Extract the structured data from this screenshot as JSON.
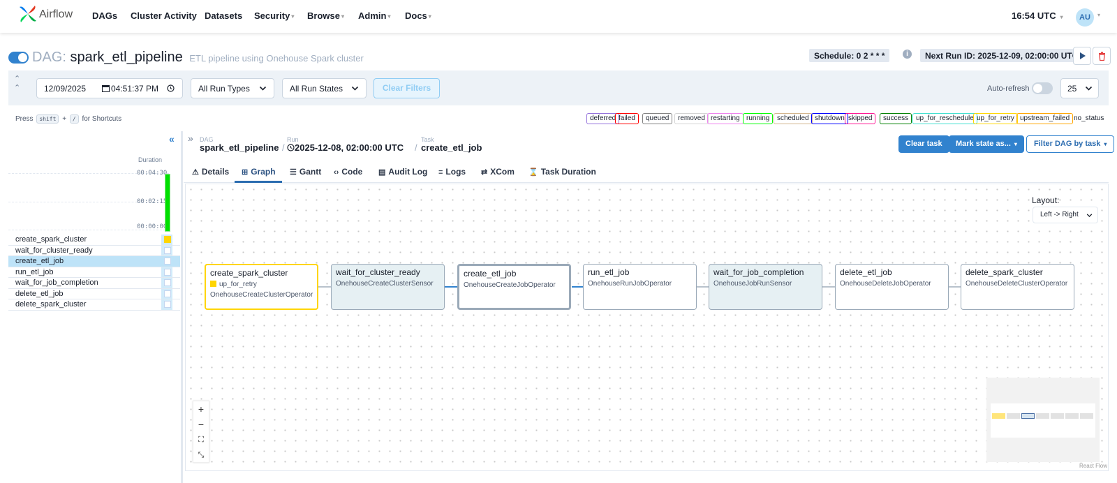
{
  "nav": {
    "brand": "Airflow",
    "items": [
      {
        "label": "DAGs",
        "caret": false
      },
      {
        "label": "Cluster Activity",
        "caret": false
      },
      {
        "label": "Datasets",
        "caret": false
      },
      {
        "label": "Security",
        "caret": true
      },
      {
        "label": "Browse",
        "caret": true
      },
      {
        "label": "Admin",
        "caret": true
      },
      {
        "label": "Docs",
        "caret": true
      }
    ],
    "clock": "16:54 UTC",
    "avatar": "AU"
  },
  "dag": {
    "prefix": "DAG:",
    "name": "spark_etl_pipeline",
    "description": "ETL pipeline using Onehouse Spark cluster",
    "schedule": "Schedule: 0 2 * * *",
    "next_run": "Next Run ID: 2025-12-09, 02:00:00 UTC",
    "paused": false
  },
  "filters": {
    "date": "12/09/2025",
    "time": "04:51:37  PM",
    "run_types": "All Run Types",
    "run_states": "All Run States",
    "clear": "Clear Filters",
    "auto_refresh": "Auto-refresh",
    "num_runs": "25"
  },
  "shortcuts": {
    "press": "Press",
    "key1": "shift",
    "plus": "+",
    "key2": "/",
    "suffix": "for Shortcuts"
  },
  "legend": [
    {
      "label": "deferred",
      "color": "#9370db"
    },
    {
      "label": "failed",
      "color": "#ff0000"
    },
    {
      "label": "queued",
      "color": "#808080"
    },
    {
      "label": "removed",
      "color": "#d3d3d3"
    },
    {
      "label": "restarting",
      "color": "#ee82ee"
    },
    {
      "label": "running",
      "color": "#00ff00"
    },
    {
      "label": "scheduled",
      "color": "#d2b48c"
    },
    {
      "label": "shutdown",
      "color": "#0000ff"
    },
    {
      "label": "skipped",
      "color": "#ff1493"
    },
    {
      "label": "success",
      "color": "#008000"
    },
    {
      "label": "up_for_reschedule",
      "color": "#40e0d0"
    },
    {
      "label": "up_for_retry",
      "color": "#ffd700"
    },
    {
      "label": "upstream_failed",
      "color": "#ffa500"
    },
    {
      "label": "no_status",
      "color": ""
    }
  ],
  "grid": {
    "duration_label": "Duration",
    "ticks": [
      "00:04:30",
      "00:02:15",
      "00:00:00"
    ],
    "tasks": [
      {
        "name": "create_spark_cluster",
        "state": "up_for_retry",
        "selected": false
      },
      {
        "name": "wait_for_cluster_ready",
        "state": "",
        "selected": false
      },
      {
        "name": "create_etl_job",
        "state": "",
        "selected": true
      },
      {
        "name": "run_etl_job",
        "state": "",
        "selected": false
      },
      {
        "name": "wait_for_job_completion",
        "state": "",
        "selected": false
      },
      {
        "name": "delete_etl_job",
        "state": "",
        "selected": false
      },
      {
        "name": "delete_spark_cluster",
        "state": "",
        "selected": false
      }
    ]
  },
  "breadcrumb": {
    "dag_label": "DAG",
    "dag_value": "spark_etl_pipeline",
    "run_label": "Run",
    "run_value": "2025-12-08, 02:00:00 UTC",
    "task_label": "Task",
    "task_value": "create_etl_job"
  },
  "actions": {
    "clear_task": "Clear task",
    "mark_state": "Mark state as...",
    "filter_dag": "Filter DAG by task"
  },
  "tabs": [
    {
      "label": "Details",
      "icon": "⚠",
      "active": false
    },
    {
      "label": "Graph",
      "icon": "⊞",
      "active": true
    },
    {
      "label": "Gantt",
      "icon": "☰",
      "active": false
    },
    {
      "label": "Code",
      "icon": "‹›",
      "active": false
    },
    {
      "label": "Audit Log",
      "icon": "▤",
      "active": false
    },
    {
      "label": "Logs",
      "icon": "≡",
      "active": false
    },
    {
      "label": "XCom",
      "icon": "⇄",
      "active": false
    },
    {
      "label": "Task Duration",
      "icon": "⌛",
      "active": false
    }
  ],
  "graph": {
    "layout_label": "Layout:",
    "layout_value": "Left -> Right",
    "nodes": [
      {
        "name": "create_spark_cluster",
        "state": "up_for_retry",
        "operator": "OnehouseCreateClusterOperator",
        "style": "retry"
      },
      {
        "name": "wait_for_cluster_ready",
        "state": "",
        "operator": "OnehouseCreateClusterSensor",
        "style": "teal"
      },
      {
        "name": "create_etl_job",
        "state": "",
        "operator": "OnehouseCreateJobOperator",
        "style": "sel"
      },
      {
        "name": "run_etl_job",
        "state": "",
        "operator": "OnehouseRunJobOperator",
        "style": "plain"
      },
      {
        "name": "wait_for_job_completion",
        "state": "",
        "operator": "OnehouseJobRunSensor",
        "style": "teal"
      },
      {
        "name": "delete_etl_job",
        "state": "",
        "operator": "OnehouseDeleteJobOperator",
        "style": "plain"
      },
      {
        "name": "delete_spark_cluster",
        "state": "",
        "operator": "OnehouseDeleteClusterOperator",
        "style": "plain"
      }
    ],
    "attribution": "React Flow"
  }
}
